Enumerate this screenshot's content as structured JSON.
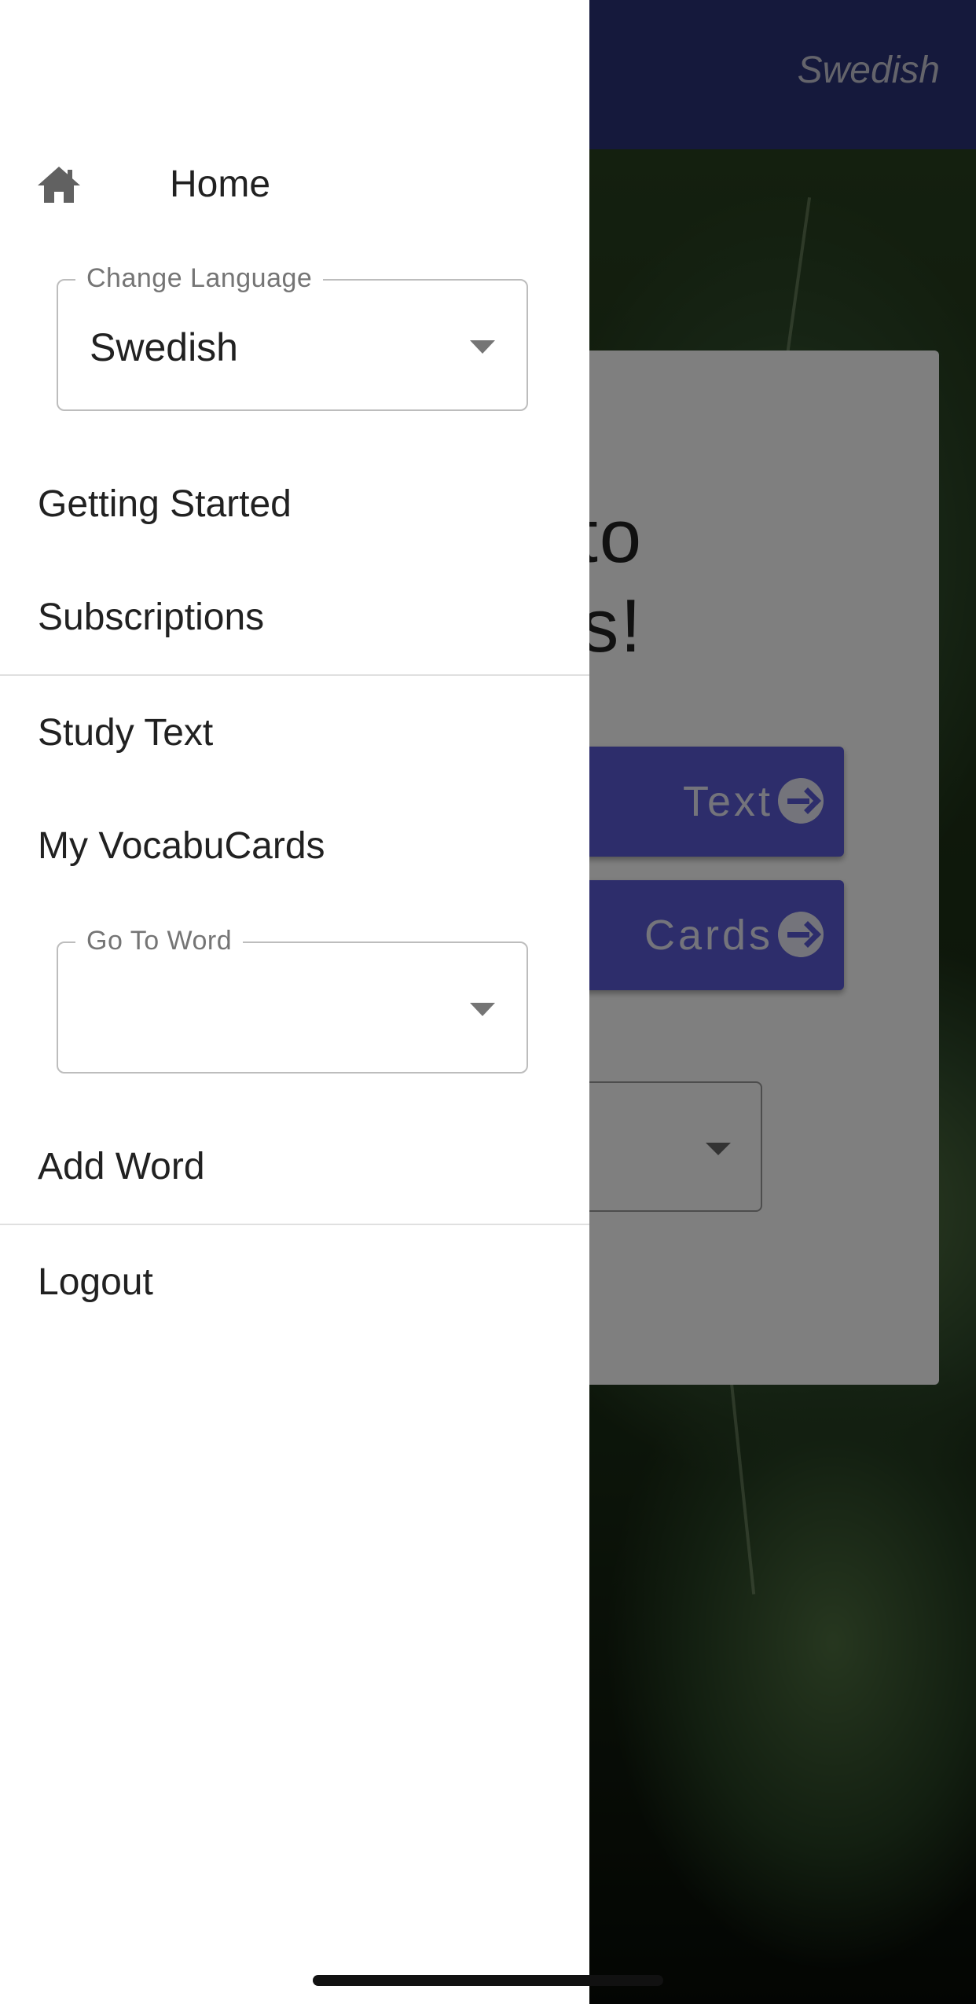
{
  "background_app": {
    "header_language": "Swedish",
    "welcome_title_fragment": "e to\nrds!",
    "study_text_button_fragment": "Text",
    "vocabucards_button_fragment": "Cards"
  },
  "drawer": {
    "home": {
      "label": "Home",
      "icon": "home-icon"
    },
    "change_language": {
      "legend": "Change Language",
      "value": "Swedish"
    },
    "items_top": [
      {
        "label": "Getting Started"
      },
      {
        "label": "Subscriptions"
      }
    ],
    "items_study": [
      {
        "label": "Study Text"
      },
      {
        "label": "My VocabuCards"
      }
    ],
    "go_to_word": {
      "legend": "Go To Word",
      "value": ""
    },
    "add_word": {
      "label": "Add Word"
    },
    "logout": {
      "label": "Logout"
    }
  },
  "colors": {
    "app_bar": "#2b3378",
    "accent_button": "#5b5bd6",
    "drawer_background": "#ffffff",
    "scrim": "rgba(0,0,0,0.5)"
  }
}
